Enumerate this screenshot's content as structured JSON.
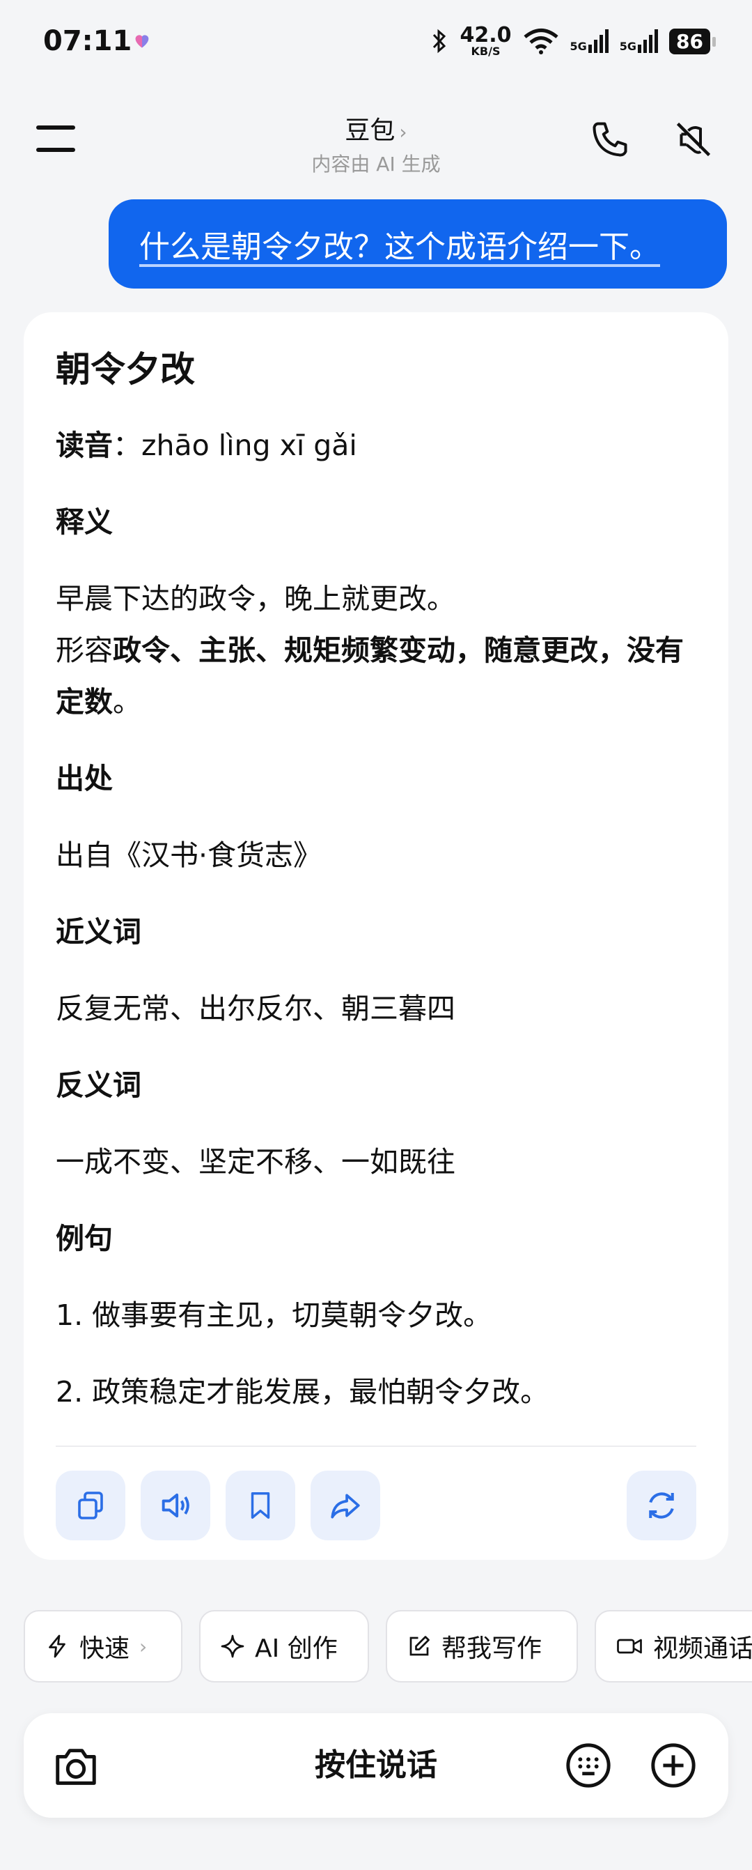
{
  "status_bar": {
    "time": "07:11",
    "speed_value": "42.0",
    "speed_unit": "KB/S",
    "signal1": "5G",
    "signal2": "5G",
    "battery": "86"
  },
  "header": {
    "title": "豆包",
    "subtitle": "内容由 AI 生成"
  },
  "user_message": "什么是朝令夕改？这个成语介绍一下。",
  "answer": {
    "title": "朝令夕改",
    "pronunciation_label": "读音",
    "pronunciation_sep": "：",
    "pronunciation": "zhāo lìng xī gǎi",
    "meaning_heading": "释义",
    "meaning_line1": "早晨下达的政令，晚上就更改。",
    "meaning_prefix": "形容",
    "meaning_bold": "政令、主张、规矩频繁变动，随意更改，没有定数",
    "meaning_suffix": "。",
    "source_heading": "出处",
    "source_text": "出自《汉书·食货志》",
    "synonyms_heading": "近义词",
    "synonyms_text": "反复无常、出尔反尔、朝三暮四",
    "antonyms_heading": "反义词",
    "antonyms_text": "一成不变、坚定不移、一如既往",
    "examples_heading": "例句",
    "example1": "1. 做事要有主见，切莫朝令夕改。",
    "example2": "2. 政策稳定才能发展，最怕朝令夕改。"
  },
  "action_icons": [
    "copy-icon",
    "speaker-icon",
    "bookmark-icon",
    "share-icon",
    "regenerate-icon"
  ],
  "chips": {
    "fast": "快速",
    "ai_create": "AI 创作",
    "write": "帮我写作",
    "video_call": "视频通话"
  },
  "input_bar": {
    "talk_label": "按住说话"
  },
  "colors": {
    "accent": "#1166ee",
    "icon_blue": "#2b6ee6",
    "action_bg": "#eaf0fc"
  }
}
